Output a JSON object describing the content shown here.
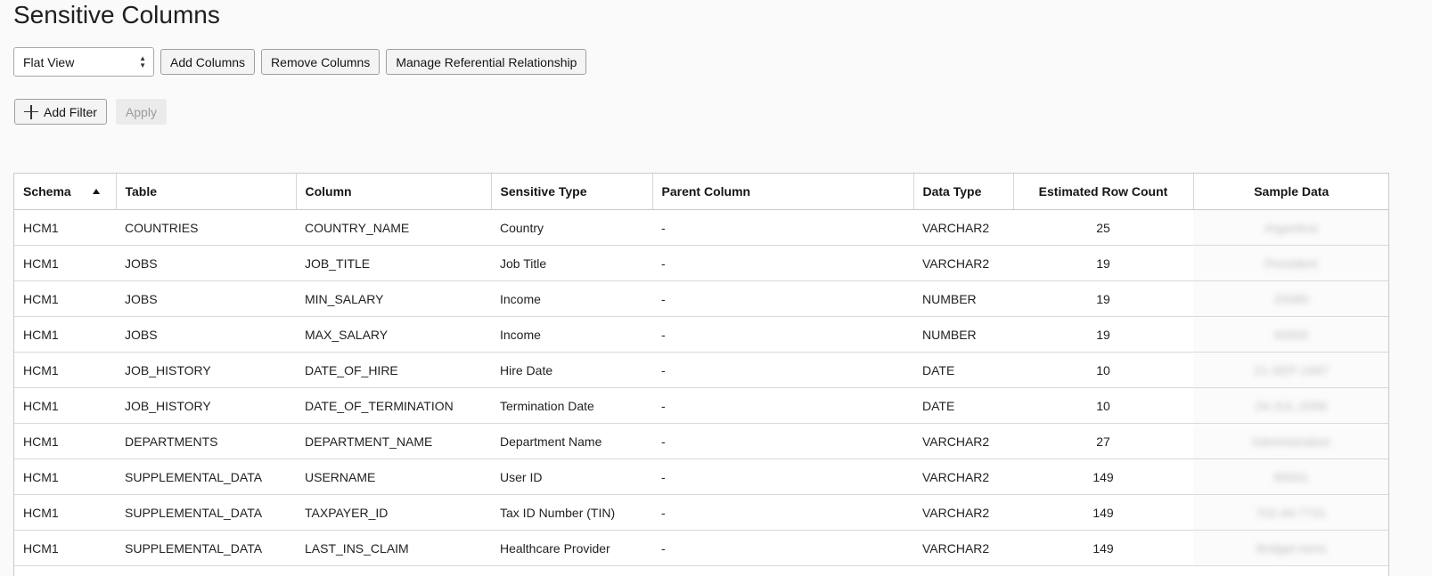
{
  "page": {
    "title": "Sensitive Columns"
  },
  "toolbar": {
    "view_select_value": "Flat View",
    "add_columns_label": "Add Columns",
    "remove_columns_label": "Remove Columns",
    "manage_referential_label": "Manage Referential Relationship"
  },
  "filter": {
    "add_filter_label": "Add Filter",
    "apply_label": "Apply"
  },
  "table": {
    "headers": {
      "schema": "Schema",
      "table": "Table",
      "column": "Column",
      "sensitive_type": "Sensitive Type",
      "parent_column": "Parent Column",
      "data_type": "Data Type",
      "estimated_row_count": "Estimated Row Count",
      "sample_data": "Sample Data"
    },
    "sort": {
      "column": "Schema",
      "direction": "ascending"
    },
    "rows": [
      {
        "schema": "HCM1",
        "table": "COUNTRIES",
        "column": "COUNTRY_NAME",
        "sensitive_type": "Country",
        "parent_column": "-",
        "data_type": "VARCHAR2",
        "row_count": "25",
        "sample": "Argentina"
      },
      {
        "schema": "HCM1",
        "table": "JOBS",
        "column": "JOB_TITLE",
        "sensitive_type": "Job Title",
        "parent_column": "-",
        "data_type": "VARCHAR2",
        "row_count": "19",
        "sample": "President"
      },
      {
        "schema": "HCM1",
        "table": "JOBS",
        "column": "MIN_SALARY",
        "sensitive_type": "Income",
        "parent_column": "-",
        "data_type": "NUMBER",
        "row_count": "19",
        "sample": "20080"
      },
      {
        "schema": "HCM1",
        "table": "JOBS",
        "column": "MAX_SALARY",
        "sensitive_type": "Income",
        "parent_column": "-",
        "data_type": "NUMBER",
        "row_count": "19",
        "sample": "40000"
      },
      {
        "schema": "HCM1",
        "table": "JOB_HISTORY",
        "column": "DATE_OF_HIRE",
        "sensitive_type": "Hire Date",
        "parent_column": "-",
        "data_type": "DATE",
        "row_count": "10",
        "sample": "21-SEP-1997"
      },
      {
        "schema": "HCM1",
        "table": "JOB_HISTORY",
        "column": "DATE_OF_TERMINATION",
        "sensitive_type": "Termination Date",
        "parent_column": "-",
        "data_type": "DATE",
        "row_count": "10",
        "sample": "24-JUL-2006"
      },
      {
        "schema": "HCM1",
        "table": "DEPARTMENTS",
        "column": "DEPARTMENT_NAME",
        "sensitive_type": "Department Name",
        "parent_column": "-",
        "data_type": "VARCHAR2",
        "row_count": "27",
        "sample": "Administration"
      },
      {
        "schema": "HCM1",
        "table": "SUPPLEMENTAL_DATA",
        "column": "USERNAME",
        "sensitive_type": "User ID",
        "parent_column": "-",
        "data_type": "VARCHAR2",
        "row_count": "149",
        "sample": "80001"
      },
      {
        "schema": "HCM1",
        "table": "SUPPLEMENTAL_DATA",
        "column": "TAXPAYER_ID",
        "sensitive_type": "Tax ID Number (TIN)",
        "parent_column": "-",
        "data_type": "VARCHAR2",
        "row_count": "149",
        "sample": "702-44-7731"
      },
      {
        "schema": "HCM1",
        "table": "SUPPLEMENTAL_DATA",
        "column": "LAST_INS_CLAIM",
        "sensitive_type": "Healthcare Provider",
        "parent_column": "-",
        "data_type": "VARCHAR2",
        "row_count": "149",
        "sample": "Bridget Aims"
      }
    ]
  }
}
